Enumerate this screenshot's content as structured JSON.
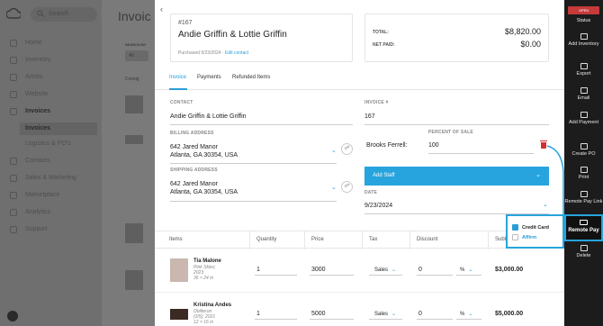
{
  "sidebar": {
    "search_placeholder": "Search",
    "items": [
      {
        "label": "Home"
      },
      {
        "label": "Inventory"
      },
      {
        "label": "Artists"
      },
      {
        "label": "Website"
      },
      {
        "label": "Invoices"
      },
      {
        "label": "Contacts"
      },
      {
        "label": "Sales & Marketing"
      },
      {
        "label": "Marketplace"
      },
      {
        "label": "Analytics"
      },
      {
        "label": "Support"
      }
    ],
    "subitems": [
      {
        "label": "Invoices"
      },
      {
        "label": "Logistics & PO's"
      }
    ]
  },
  "background": {
    "title": "Invoic",
    "search_by_label": "SEARCH BY",
    "select_value": "All",
    "column_label": "Consig"
  },
  "contact_card": {
    "invoice_number": "#167",
    "name": "Andie Griffin & Lottie Griffin",
    "purchased": "Purchased 9/23/2024 ·",
    "edit_link": "Edit contact"
  },
  "totals": {
    "total_label": "TOTAL:",
    "total_value": "$8,820.00",
    "net_paid_label": "NET PAID:",
    "net_paid_value": "$0.00"
  },
  "tabs": [
    {
      "label": "Invoice"
    },
    {
      "label": "Payments"
    },
    {
      "label": "Refunded Items"
    }
  ],
  "form": {
    "contact_label": "CONTACT",
    "contact_value": "Andie Griffin & Lottie Griffin",
    "billing_label": "BILLING ADDRESS",
    "billing_line1": "642 Jared Manor",
    "billing_line2": "Atlanta, GA 30354, USA",
    "shipping_label": "SHIPPING ADDRESS",
    "shipping_line1": "642 Jared Manor",
    "shipping_line2": "Atlanta, GA 30354, USA",
    "invoice_no_label": "INVOICE #",
    "invoice_no_value": "167",
    "percent_label": "PERCENT OF SALE",
    "staff_name": "Brooks Ferrell:",
    "percent_value": "100",
    "add_staff_label": "Add Staff",
    "date_label": "DATE",
    "date_value": "9/23/2024"
  },
  "items_table": {
    "headers": [
      "Items",
      "Quantity",
      "Price",
      "Tax",
      "Discount",
      "Subto"
    ],
    "rows": [
      {
        "title": "Tia Malone",
        "sub1": "Pink Skies;",
        "sub2": "2023",
        "sub3": "36 × 24 in",
        "qty": "1",
        "price": "3000",
        "tax": "Sales",
        "discount": "0",
        "disc_type": "%",
        "subtotal": "$3,000.00"
      },
      {
        "title": "Kristina Andes",
        "sub1": "Obliteron",
        "sub2": "(3/5); 2021",
        "sub3": "12 × 16 in",
        "qty": "1",
        "price": "5000",
        "tax": "Sales",
        "discount": "0",
        "disc_type": "%",
        "subtotal": "$5,000.00"
      }
    ]
  },
  "right_toolbar": {
    "status": "OPEN",
    "items": [
      {
        "label": "Status"
      },
      {
        "label": "Add Inventory"
      },
      {
        "label": "Export"
      },
      {
        "label": "Email"
      },
      {
        "label": "Add Payment"
      },
      {
        "label": "Create PO"
      },
      {
        "label": "Print"
      },
      {
        "label": "Remote Pay Link"
      },
      {
        "label": "Remote Pay"
      },
      {
        "label": "Delete"
      }
    ]
  },
  "pay_popup": {
    "credit_card": "Credit Card",
    "affirm": "Affirm"
  },
  "colors": {
    "accent": "#27a4dd",
    "danger": "#d43030",
    "toolbar_bg": "#1c1c1c"
  }
}
